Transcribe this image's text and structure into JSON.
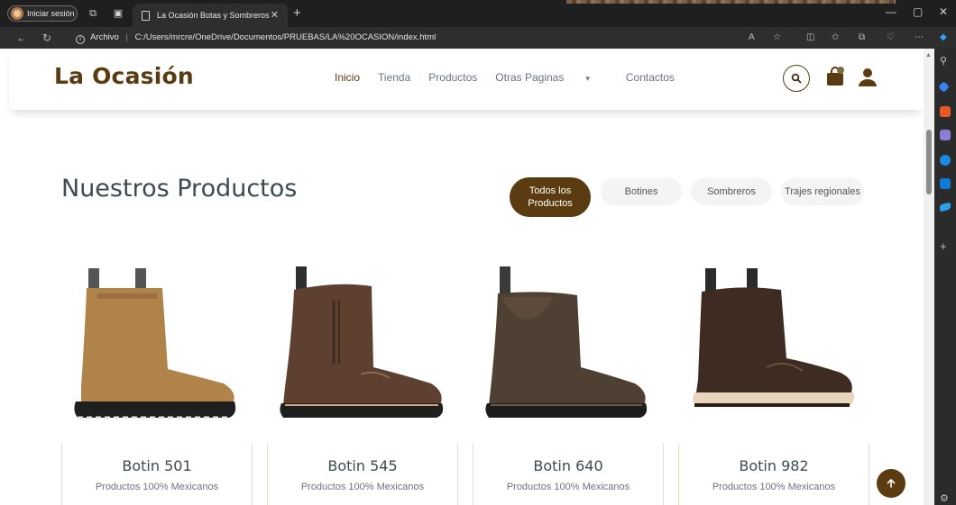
{
  "browser": {
    "profile_label": "Iniciar sesión",
    "tab_title": "La Ocasión Botas y Sombreros",
    "url_label": "Archivo",
    "url": "C:/Users/mrcre/OneDrive/Documentos/PRUEBAS/LA%20OCASION/index.html"
  },
  "site": {
    "logo": "La Ocasión",
    "nav": {
      "inicio": "Inicio",
      "tienda": "Tienda",
      "productos": "Productos",
      "otras": "Otras Paginas",
      "contactos": "Contactos"
    }
  },
  "section": {
    "title": "Nuestros Productos",
    "filters": [
      "Todos los Productos",
      "Botines",
      "Sombreros",
      "Trajes regionales"
    ]
  },
  "products": [
    {
      "name": "Botin 501",
      "subtitle": "Productos 100% Mexicanos",
      "color": "#b0834a"
    },
    {
      "name": "Botin 545",
      "subtitle": "Productos 100% Mexicanos",
      "color": "#5e4030"
    },
    {
      "name": "Botin 640",
      "subtitle": "Productos 100% Mexicanos",
      "color": "#4f4034"
    },
    {
      "name": "Botin 982",
      "subtitle": "Productos 100% Mexicanos",
      "color": "#3e2b21"
    }
  ],
  "colors": {
    "brand": "#5b3c11",
    "text_heading": "#3d4a52",
    "muted": "#6b7280"
  }
}
